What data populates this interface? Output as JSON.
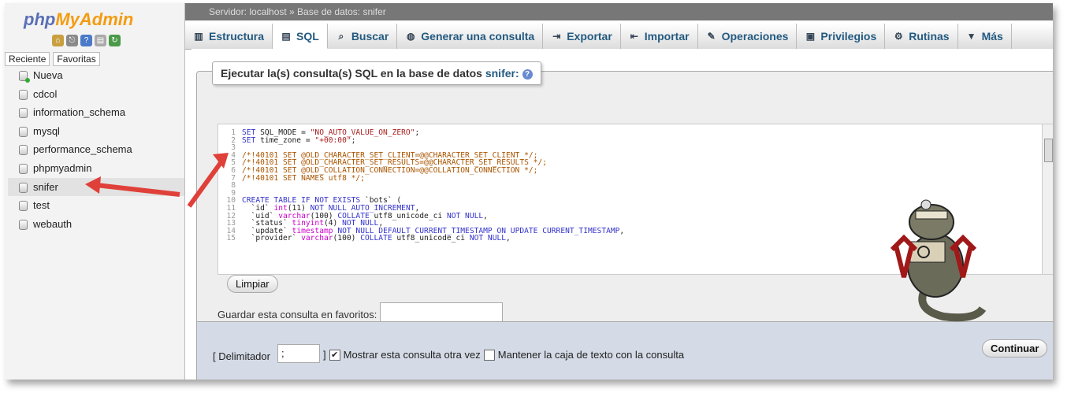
{
  "app": {
    "logo_part1": "php",
    "logo_part2": "MyAdmin",
    "topbar_text": "Servidor: localhost » Base de datos: snifer"
  },
  "sidebar": {
    "tabs": [
      "Reciente",
      "Favoritas"
    ],
    "databases": [
      {
        "name": "Nueva",
        "new": true
      },
      {
        "name": "cdcol"
      },
      {
        "name": "information_schema"
      },
      {
        "name": "mysql"
      },
      {
        "name": "performance_schema"
      },
      {
        "name": "phpmyadmin"
      },
      {
        "name": "snifer",
        "active": true
      },
      {
        "name": "test"
      },
      {
        "name": "webauth"
      }
    ]
  },
  "tabs": [
    {
      "label": "Estructura",
      "icon": "structure-icon"
    },
    {
      "label": "SQL",
      "icon": "sql-icon",
      "active": true
    },
    {
      "label": "Buscar",
      "icon": "search-icon"
    },
    {
      "label": "Generar una consulta",
      "icon": "query-icon"
    },
    {
      "label": "Exportar",
      "icon": "export-icon"
    },
    {
      "label": "Importar",
      "icon": "import-icon"
    },
    {
      "label": "Operaciones",
      "icon": "wrench-icon"
    },
    {
      "label": "Privilegios",
      "icon": "privileges-icon"
    },
    {
      "label": "Rutinas",
      "icon": "routines-icon"
    },
    {
      "label": "Más",
      "icon": "chevron-down-icon"
    }
  ],
  "panel": {
    "title_prefix": "Ejecutar la(s) consulta(s) SQL en la base de datos",
    "database": "snifer:",
    "clear_label": "Limpiar",
    "favorite_label": "Guardar esta consulta en favoritos:",
    "favorite_value": ""
  },
  "editor": {
    "lines": [
      {
        "n": "1",
        "html": "<span class='kw'>SET</span> SQL_MODE = <span class='st'>\"NO_AUTO_VALUE_ON_ZERO\"</span>;"
      },
      {
        "n": "2",
        "html": "<span class='kw'>SET</span> time_zone = <span class='st'>\"+00:00\"</span>;"
      },
      {
        "n": "3",
        "html": ""
      },
      {
        "n": "4",
        "html": "<span class='cm'>/*!40101 SET @OLD_CHARACTER_SET_CLIENT=@@CHARACTER_SET_CLIENT */;</span>"
      },
      {
        "n": "5",
        "html": "<span class='cm'>/*!40101 SET @OLD_CHARACTER_SET_RESULTS=@@CHARACTER_SET_RESULTS */;</span>"
      },
      {
        "n": "6",
        "html": "<span class='cm'>/*!40101 SET @OLD_COLLATION_CONNECTION=@@COLLATION_CONNECTION */;</span>"
      },
      {
        "n": "7",
        "html": "<span class='cm'>/*!40101 SET NAMES utf8 */;</span>"
      },
      {
        "n": "8",
        "html": ""
      },
      {
        "n": "9",
        "html": ""
      },
      {
        "n": "10",
        "html": "<span class='kw'>CREATE TABLE IF NOT EXISTS</span> `bots` ("
      },
      {
        "n": "11",
        "html": "  `id` <span class='fn'>int</span>(11) <span class='kw'>NOT NULL AUTO_INCREMENT</span>,"
      },
      {
        "n": "12",
        "html": "  `uid` <span class='fn'>varchar</span>(100) <span class='kw'>COLLATE</span> utf8_unicode_ci <span class='kw'>NOT NULL</span>,"
      },
      {
        "n": "13",
        "html": "  `status` <span class='fn'>tinyint</span>(4) <span class='kw'>NOT NULL</span>,"
      },
      {
        "n": "14",
        "html": "  `update` <span class='fn'>timestamp</span> <span class='kw'>NOT NULL DEFAULT CURRENT_TIMESTAMP ON UPDATE CURRENT_TIMESTAMP</span>,"
      },
      {
        "n": "15",
        "html": "  `provider` <span class='fn'>varchar</span>(100) <span class='kw'>COLLATE</span> utf8_unicode_ci <span class='kw'>NOT NULL</span>,"
      }
    ]
  },
  "bottom": {
    "delimiter_label": "[ Delimitador",
    "delimiter_value": ";",
    "close_bracket": "]",
    "show_query_label": "Mostrar esta consulta otra vez",
    "keep_box_label": "Mantener la caja de texto con la consulta",
    "submit_label": "Continuar"
  }
}
